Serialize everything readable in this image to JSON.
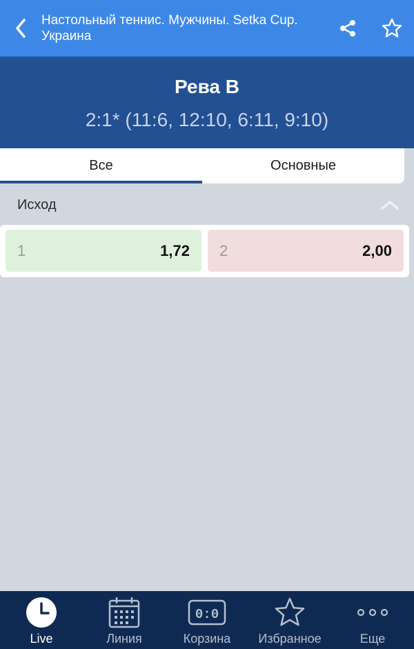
{
  "header": {
    "title_line1": "Настольный теннис. Мужчины. Setka Cup.",
    "title_line2": "Украина"
  },
  "match": {
    "player": "Рева В",
    "score": "2:1* (11:6, 12:10, 6:11, 9:10)"
  },
  "tabs": [
    {
      "label": "Все",
      "active": true
    },
    {
      "label": "Основные",
      "active": false
    }
  ],
  "section": {
    "title": "Исход",
    "expanded": true
  },
  "outcomes": [
    {
      "label": "1",
      "value": "1,72",
      "color": "#dff1dc"
    },
    {
      "label": "2",
      "value": "2,00",
      "color": "#f1dddd"
    }
  ],
  "nav": [
    {
      "label": "Live",
      "icon": "clock-icon",
      "active": true
    },
    {
      "label": "Линия",
      "icon": "calendar-icon",
      "active": false
    },
    {
      "label": "Корзина",
      "icon": "scoreboard-icon",
      "icon_text": "0:0",
      "active": false
    },
    {
      "label": "Избранное",
      "icon": "star-icon",
      "active": false
    },
    {
      "label": "Еще",
      "icon": "more-icon",
      "active": false
    }
  ],
  "colors": {
    "topbar": "#3d88e6",
    "match_header": "#234f93",
    "bottom_nav": "#0f2a52",
    "background": "#d1d7de"
  }
}
